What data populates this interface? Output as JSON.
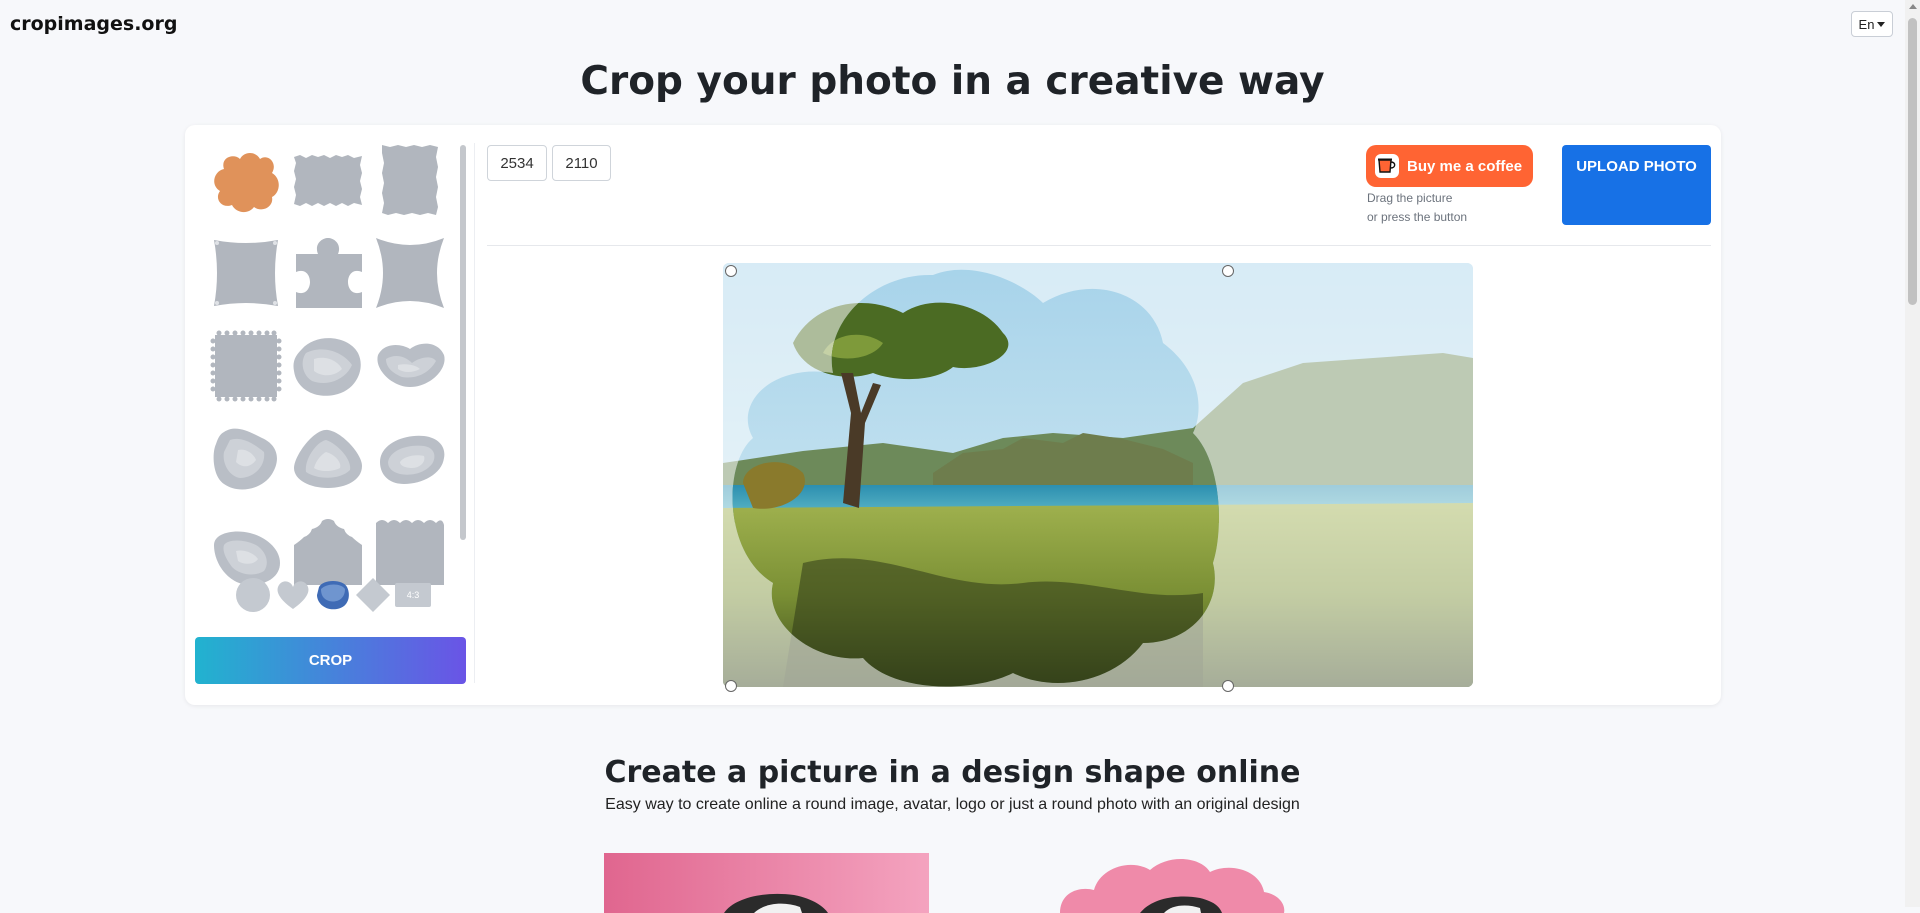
{
  "header": {
    "logo_text": "cropimages.org",
    "language_label": "En"
  },
  "main": {
    "title": "Crop your photo in a creative way"
  },
  "editor": {
    "width_value": "2534",
    "height_value": "2110",
    "coffee_label": "Buy me a coffee",
    "hint_line1": "Drag the picture",
    "hint_line2": "or press the button",
    "upload_label": "UPLOAD PHOTO",
    "crop_label": "CROP",
    "mini_ratio_label": "4:3",
    "shapes": [
      "cloud",
      "ragged-square",
      "ragged-tall",
      "pinned-square",
      "puzzle",
      "star-wave",
      "stamp",
      "blob-1",
      "blob-2",
      "pebble-1",
      "pebble-2",
      "pebble-3",
      "pebble-4",
      "scallop-house",
      "scallop-rect"
    ],
    "mini_shapes": [
      "circle",
      "heart",
      "blue-blob",
      "diamond",
      "ratio-4-3"
    ],
    "selected_shape": "cloud",
    "accent_color": "#e0925a"
  },
  "section2": {
    "title": "Create a picture in a design shape online",
    "description": "Easy way to create online a round image, avatar, logo or just a round photo with an original design"
  },
  "colors": {
    "crop_gradient_start": "#21b3cf",
    "crop_gradient_end": "#6a54e6",
    "upload_blue": "#1771e6",
    "coffee_orange": "#ff6433",
    "shape_gray": "#b1b6be"
  }
}
